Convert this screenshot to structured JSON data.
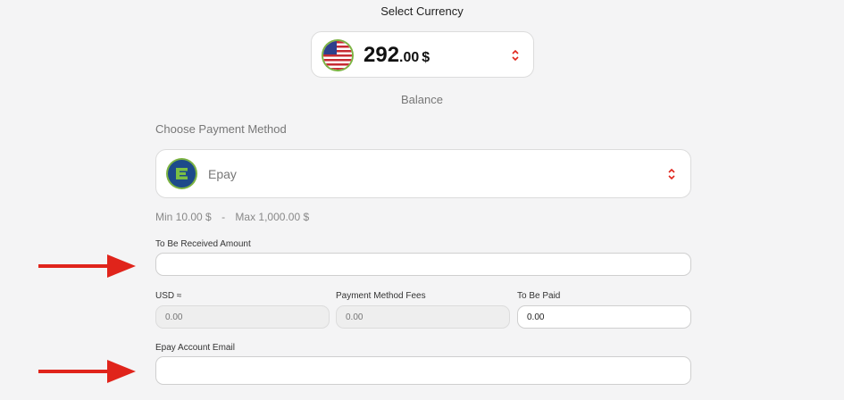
{
  "currency": {
    "heading": "Select Currency",
    "amount_int": "292",
    "amount_dec": ".00",
    "symbol": "$",
    "flag_icon": "us-flag-icon",
    "balance_label": "Balance"
  },
  "payment": {
    "section_label": "Choose Payment Method",
    "method_name": "Epay",
    "method_icon": "epay-logo-icon",
    "min_label": "Min 10.00 $",
    "separator": "-",
    "max_label": "Max 1,000.00 $"
  },
  "form": {
    "received_amount_label": "To Be Received Amount",
    "received_amount_value": "",
    "usd_label": "USD ≈",
    "usd_placeholder": "0.00",
    "fees_label": "Payment Method Fees",
    "fees_placeholder": "0.00",
    "to_be_paid_label": "To Be Paid",
    "to_be_paid_value": "0.00",
    "email_label": "Epay Account Email",
    "email_value": ""
  },
  "colors": {
    "accent_red": "#e0241b",
    "green_ring": "#7cb342",
    "background": "#f4f4f5"
  }
}
